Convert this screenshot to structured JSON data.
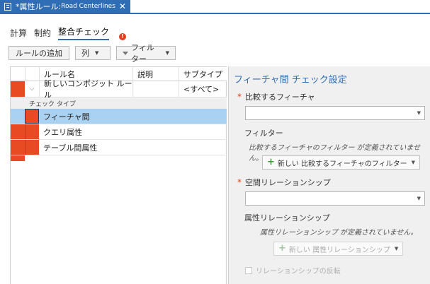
{
  "tab": {
    "title": "*属性ルール: ",
    "layer": "Road Centerlines",
    "close": "✕",
    "icon": "rules-view-icon"
  },
  "subnav": {
    "items": [
      "計算",
      "制約",
      "整合チェック"
    ],
    "active": "整合チェック",
    "warning_glyph": "!"
  },
  "toolbar": {
    "add_rule": "ルールの追加",
    "columns": "列",
    "filter": "フィルター"
  },
  "grid": {
    "columns": [
      "ルール名",
      "説明",
      "サブタイプ"
    ],
    "parent_row": {
      "name": "新しいコンポジット ルール",
      "description": "",
      "subtype": "<すべて>"
    },
    "group_label": "チェック タイプ",
    "check_types": [
      "フィーチャ間",
      "クエリ属性",
      "テーブル間属性"
    ],
    "selected_index": 0,
    "accent_color": "#e84b24",
    "selection_color": "#a9d1f1"
  },
  "panel": {
    "title": "フィーチャ間 チェック設定",
    "compare_feature_label": "比較するフィーチャ",
    "compare_feature_value": "",
    "filter_label": "フィルター",
    "filter_note": "比較するフィーチャのフィルター が定義されていません。",
    "new_filter_button": "新しい 比較するフィーチャのフィルター",
    "spatial_relationship_label": "空間リレーションシップ",
    "spatial_relationship_value": "",
    "attribute_relationship_label": "属性リレーションシップ",
    "attribute_relationship_note": "属性リレーションシップ が定義されていません。",
    "new_attribute_button": "新しい 属性リレーションシップ",
    "invert_relationship_label": "リレーションシップの反転",
    "required_mark": "*"
  }
}
